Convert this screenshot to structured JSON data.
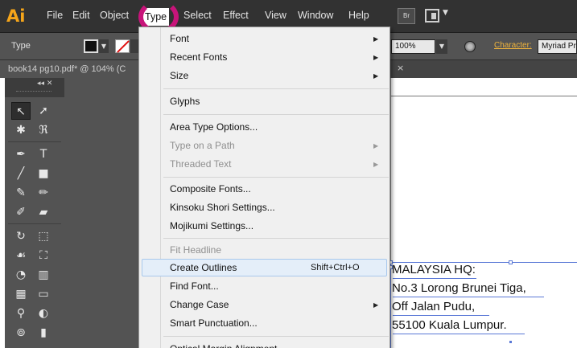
{
  "app": {
    "logo": "Ai"
  },
  "menubar": {
    "items": [
      "File",
      "Edit",
      "Object",
      "Type",
      "Select",
      "Effect",
      "View",
      "Window",
      "Help"
    ],
    "active": "Type",
    "bridge_label": "Br"
  },
  "control_bar": {
    "label": "Type",
    "opacity": "100%",
    "character_link": "Character:",
    "font_name": "Myriad Pro"
  },
  "document_tab": {
    "title": "book14 pg10.pdf* @ 104% (C",
    "close": "×"
  },
  "type_menu": {
    "items": [
      {
        "label": "Font",
        "submenu": true,
        "enabled": true
      },
      {
        "label": "Recent Fonts",
        "submenu": true,
        "enabled": true
      },
      {
        "label": "Size",
        "submenu": true,
        "enabled": true
      },
      {
        "label": "Glyphs",
        "submenu": false,
        "enabled": true
      },
      {
        "label": "Area Type Options...",
        "submenu": false,
        "enabled": true
      },
      {
        "label": "Type on a Path",
        "submenu": true,
        "enabled": false
      },
      {
        "label": "Threaded Text",
        "submenu": true,
        "enabled": false
      },
      {
        "label": "Composite Fonts...",
        "submenu": false,
        "enabled": true
      },
      {
        "label": "Kinsoku Shori Settings...",
        "submenu": false,
        "enabled": true
      },
      {
        "label": "Mojikumi Settings...",
        "submenu": false,
        "enabled": true
      },
      {
        "label": "Fit Headline",
        "submenu": false,
        "enabled": false
      },
      {
        "label": "Create Outlines",
        "submenu": false,
        "enabled": true,
        "shortcut": "Shift+Ctrl+O",
        "highlighted": true
      },
      {
        "label": "Find Font...",
        "submenu": false,
        "enabled": true
      },
      {
        "label": "Change Case",
        "submenu": true,
        "enabled": true
      },
      {
        "label": "Smart Punctuation...",
        "submenu": false,
        "enabled": true
      },
      {
        "label": "Optical Margin Alignment",
        "submenu": false,
        "enabled": true
      }
    ]
  },
  "artboard_text": {
    "lines": [
      "MALAYSIA HQ:",
      "No.3 Lorong Brunei Tiga,",
      "Off Jalan Pudu,",
      "55100 Kuala Lumpur."
    ]
  },
  "tools": [
    "selection-tool",
    "direct-selection-tool",
    "magic-wand-tool",
    "lasso-tool",
    "pen-tool",
    "type-tool",
    "line-tool",
    "rectangle-tool",
    "paintbrush-tool",
    "pencil-tool",
    "blob-brush-tool",
    "eraser-tool",
    "rotate-tool",
    "scale-tool",
    "warp-tool",
    "free-transform-tool",
    "shape-builder-tool",
    "perspective-grid-tool",
    "mesh-tool",
    "gradient-tool",
    "eyedropper-tool",
    "blend-tool",
    "symbol-sprayer-tool",
    "column-graph-tool"
  ],
  "colors": {
    "accent_ring": "#c8147a",
    "logo": "#f5a51a",
    "selection": "#5a78d6",
    "menu_hover": "#e4eef9"
  }
}
